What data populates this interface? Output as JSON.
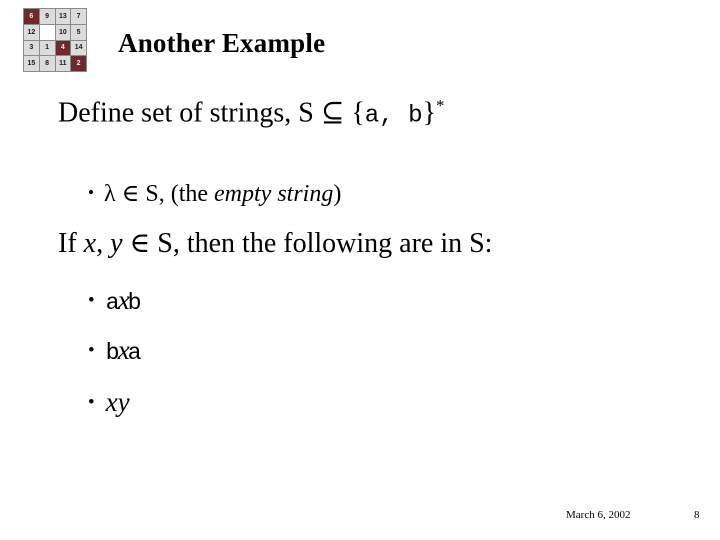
{
  "logo": {
    "name": "fifteen-puzzle-grid",
    "colors": {
      "dark": "#6d2a2a",
      "light": "#dcdcdc",
      "grid_line": "#8a8a8a"
    },
    "cells": [
      {
        "label": "6",
        "style": "dark"
      },
      {
        "label": "9",
        "style": "light"
      },
      {
        "label": "13",
        "style": "light"
      },
      {
        "label": "7",
        "style": "light"
      },
      {
        "label": "12",
        "style": "light"
      },
      {
        "label": "",
        "style": "empty"
      },
      {
        "label": "10",
        "style": "light"
      },
      {
        "label": "5",
        "style": "light"
      },
      {
        "label": "3",
        "style": "light"
      },
      {
        "label": "1",
        "style": "light"
      },
      {
        "label": "4",
        "style": "dark"
      },
      {
        "label": "14",
        "style": "light"
      },
      {
        "label": "15",
        "style": "light"
      },
      {
        "label": "8",
        "style": "light"
      },
      {
        "label": "11",
        "style": "light"
      },
      {
        "label": "2",
        "style": "dark"
      }
    ]
  },
  "title": "Another Example",
  "body": {
    "define": {
      "prefix": "Define set of strings, S ",
      "subset_symbol": "⊆",
      "open_brace": " {",
      "sym_a": "a",
      "comma": ", ",
      "sym_b": "b",
      "close_brace": "}",
      "star": "*"
    },
    "lambda_bullet": {
      "dot": "•",
      "lambda": "λ",
      "element_symbol": " ∈ ",
      "set_name": "S,",
      "paren_open": "  (the ",
      "emphasis": "empty string",
      "paren_close": ")"
    },
    "if_line": {
      "prefix": "If ",
      "var_x": "x",
      "comma": ", ",
      "var_y": "y",
      "element_symbol": " ∈ ",
      "suffix": "S, then the following are in S:"
    },
    "bullets": [
      {
        "dot": "•",
        "left": "a",
        "var": "x",
        "right": "b"
      },
      {
        "dot": "•",
        "left": "b",
        "var": "x",
        "right": "a"
      },
      {
        "dot": "•",
        "left": "",
        "var": "xy",
        "right": ""
      }
    ]
  },
  "footer": {
    "date": "March 6, 2002",
    "page_number": "8"
  }
}
